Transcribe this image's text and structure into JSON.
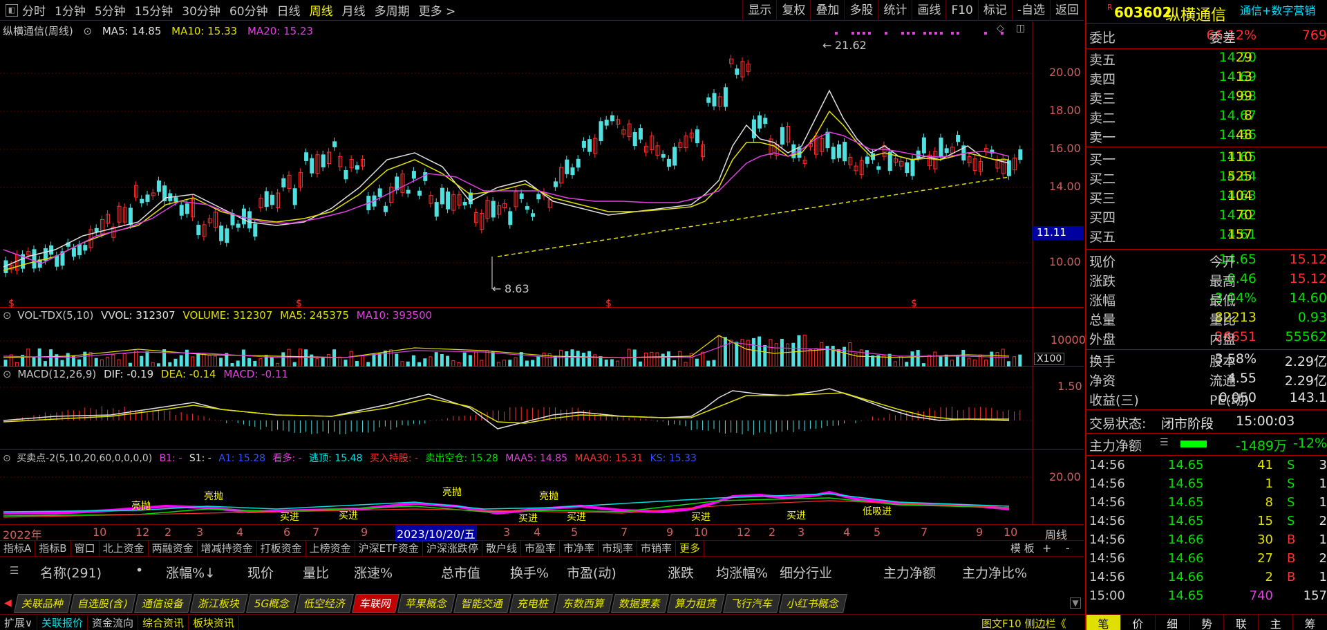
{
  "period_bar": {
    "items": [
      "分时",
      "1分钟",
      "5分钟",
      "15分钟",
      "30分钟",
      "60分钟",
      "日线",
      "周线",
      "月线",
      "多周期",
      "更多 >"
    ],
    "active": "周线"
  },
  "tools": [
    "显示",
    "复权",
    "叠加",
    "多股",
    "统计",
    "画线",
    "F10",
    "标记",
    "-自选",
    "返回"
  ],
  "main_chart": {
    "title": "纵横通信(周线)",
    "ma5": "MA5: 14.85",
    "ma10": "MA10: 15.33",
    "ma20": "MA20: 15.23",
    "high_label": "21.62",
    "low_label": "8.63",
    "current_price_tag": "11.11",
    "yticks": [
      "20.00",
      "18.00",
      "16.00",
      "14.00",
      "10.00"
    ]
  },
  "vol_chart": {
    "title": "VOL-TDX(5,10)",
    "vvol": "VVOL: 312307",
    "volume": "VOLUME: 312307",
    "ma5": "MA5: 245375",
    "ma10": "MA10: 393500",
    "ytick": "10000",
    "unit": "X100"
  },
  "macd_chart": {
    "title": "MACD(12,26,9)",
    "dif": "DIF: -0.19",
    "dea": "DEA: -0.14",
    "macd": "MACD: -0.11",
    "ytick": "1.50"
  },
  "bs_chart": {
    "title": "买卖点-2(5,10,20,60,0,0,0,0)",
    "b1": "B1: -",
    "s1": "S1: -",
    "a1": "A1: 15.28",
    "kanduo": "看多: -",
    "taoding": "逃顶: 15.48",
    "mairu": "买入持股: -",
    "maichu": "卖出空仓: 15.28",
    "maa5": "MAA5: 14.85",
    "maa30": "MAA30: 15.31",
    "ks": "KS: 15.33",
    "ytick": "20.00",
    "labels": [
      "亮抛",
      "亮抛",
      "买进",
      "买进",
      "买进",
      "亮抛",
      "亮抛",
      "买进",
      "买进",
      "买进",
      "低吸进"
    ]
  },
  "time_axis": {
    "labels": [
      "2022年",
      "10",
      "12",
      "2",
      "3",
      "4",
      "6",
      "7",
      "9",
      "3",
      "4",
      "5",
      "7",
      "9",
      "10",
      "12",
      "2",
      "3",
      "4",
      "5",
      "7",
      "9",
      "10"
    ],
    "cursor_date": "2023/10/20/五",
    "period": "周线"
  },
  "indicator_tabs": [
    "指标A",
    "指标B",
    "窗口",
    "北上资金",
    "两融资金",
    "增减持资金",
    "打板资金",
    "上榜资金",
    "沪深ETF资金",
    "沪深涨跌停",
    "散户线",
    "市盈率",
    "市净率",
    "市现率",
    "市销率",
    "更多"
  ],
  "indicator_right": [
    "模 板",
    "+",
    "-"
  ],
  "table_header": {
    "cols": [
      "名称(291)",
      "•",
      "涨幅%↓",
      "现价",
      "量比",
      "涨速%",
      "总市值",
      "换手%",
      "市盈(动)",
      "涨跌",
      "均涨幅%",
      "细分行业",
      "主力净额",
      "主力净比%"
    ]
  },
  "sector_tabs": {
    "items": [
      "关联品种",
      "自选股(含)",
      "通信设备",
      "浙江板块",
      "5G概念",
      "低空经济",
      "车联网",
      "苹果概念",
      "智能交通",
      "充电桩",
      "东数西算",
      "数据要素",
      "算力租赁",
      "飞行汽车",
      "小红书概念"
    ],
    "active": "车联网"
  },
  "status_bar": {
    "left": [
      "扩展∨",
      "关联报价",
      "资金流向",
      "综合资讯",
      "板块资讯"
    ],
    "right": "图文F10 侧边栏《",
    "bottom_tabs": [
      "笔",
      "价",
      "细",
      "势",
      "联",
      "主",
      "筹"
    ]
  },
  "quote": {
    "code": "603602",
    "name": "纵横通信",
    "tag": "通信+数字营销",
    "weibi_label": "委比",
    "weibi": "66.12%",
    "weicha_label": "委差",
    "weicha": "769",
    "asks": [
      {
        "label": "卖五",
        "price": "14.70",
        "vol": "29"
      },
      {
        "label": "卖四",
        "price": "14.69",
        "vol": "13"
      },
      {
        "label": "卖三",
        "price": "14.68",
        "vol": "99"
      },
      {
        "label": "卖二",
        "price": "14.67",
        "vol": "8"
      },
      {
        "label": "卖一",
        "price": "14.66",
        "vol": "48"
      }
    ],
    "bids": [
      {
        "label": "买一",
        "price": "14.65",
        "vol": "110"
      },
      {
        "label": "买二",
        "price": "14.64",
        "vol": "525"
      },
      {
        "label": "买三",
        "price": "14.63",
        "vol": "104"
      },
      {
        "label": "买四",
        "price": "14.62",
        "vol": "70"
      },
      {
        "label": "买五",
        "price": "14.61",
        "vol": "157"
      }
    ],
    "stats": [
      {
        "l": "现价",
        "v": "14.65",
        "c": "green",
        "l2": "今开",
        "v2": "15.12",
        "c2": "red"
      },
      {
        "l": "涨跌",
        "v": "-0.46",
        "c": "green",
        "l2": "最高",
        "v2": "15.12",
        "c2": "red"
      },
      {
        "l": "涨幅",
        "v": "-3.04%",
        "c": "green",
        "l2": "最低",
        "v2": "14.60",
        "c2": "green"
      },
      {
        "l": "总量",
        "v": "82213",
        "c": "yellow",
        "l2": "量比",
        "v2": "0.93",
        "c2": "green"
      },
      {
        "l": "外盘",
        "v": "26651",
        "c": "red",
        "l2": "内盘",
        "v2": "55562",
        "c2": "green"
      }
    ],
    "stats2": [
      {
        "l": "换手",
        "v": "3.58%",
        "l2": "股本",
        "v2": "2.29亿"
      },
      {
        "l": "净资",
        "v": "4.55",
        "l2": "流通",
        "v2": "2.29亿"
      },
      {
        "l": "收益(三)",
        "v": "0.050",
        "l2": "PE(动)",
        "v2": "143.1"
      }
    ],
    "trade_state_label": "交易状态:",
    "trade_state": "闭市阶段",
    "trade_time": "15:00:03",
    "mainflow_label": "主力净额",
    "mainflow": "-1489万",
    "mainflow_pct": "-12%",
    "ticks": [
      {
        "t": "14:56",
        "p": "14.65",
        "v": "41",
        "s": "S",
        "n": "3"
      },
      {
        "t": "14:56",
        "p": "14.65",
        "v": "1",
        "s": "S",
        "n": "1"
      },
      {
        "t": "14:56",
        "p": "14.65",
        "v": "8",
        "s": "S",
        "n": "1"
      },
      {
        "t": "14:56",
        "p": "14.65",
        "v": "15",
        "s": "S",
        "n": "2"
      },
      {
        "t": "14:56",
        "p": "14.66",
        "v": "30",
        "s": "B",
        "n": "1"
      },
      {
        "t": "14:56",
        "p": "14.66",
        "v": "27",
        "s": "B",
        "n": "2"
      },
      {
        "t": "14:56",
        "p": "14.66",
        "v": "2",
        "s": "B",
        "n": "1"
      },
      {
        "t": "15:00",
        "p": "14.65",
        "v": "740",
        "s": "",
        "n": "157"
      }
    ]
  }
}
